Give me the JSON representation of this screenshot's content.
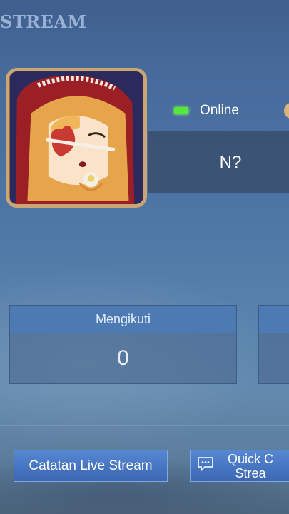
{
  "header": {
    "title": "STREAM"
  },
  "profile": {
    "status": "Online",
    "name": "N?"
  },
  "stats": [
    {
      "label": "Mengikuti",
      "value": "0"
    },
    {
      "label": "",
      "value": ""
    }
  ],
  "buttons": {
    "record": "Catatan Live Stream",
    "quick": "Quick C\nStrea"
  },
  "colors": {
    "online": "#57e63a",
    "button": "#4a78c4",
    "frame": "#c9a673"
  },
  "icons": {
    "status": "online-indicator-icon",
    "chat": "chat-bubble-icon"
  }
}
